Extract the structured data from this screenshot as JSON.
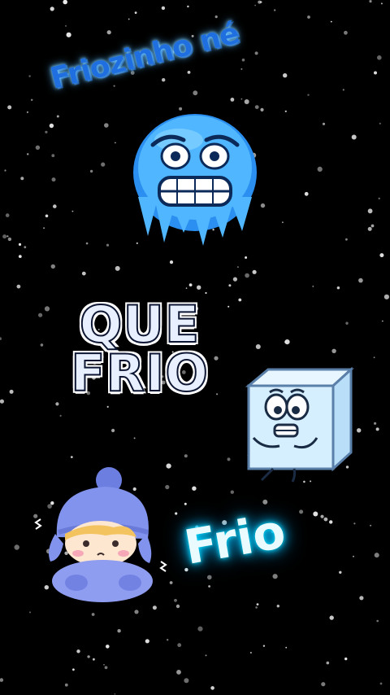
{
  "captions": {
    "top": "Friozinho né",
    "bottom": "Frio"
  },
  "sticker": {
    "line1": "QUE",
    "line2": "FRIO"
  },
  "colors": {
    "background": "#000000",
    "emoji_blue": "#3aa7ff",
    "ice": "#cfeeff",
    "glow": "#00d0ff",
    "coat": "#8f9df0"
  },
  "icons": [
    "freezing-face-emoji",
    "ice-cube-character",
    "bundled-child-character",
    "snowflakes"
  ]
}
